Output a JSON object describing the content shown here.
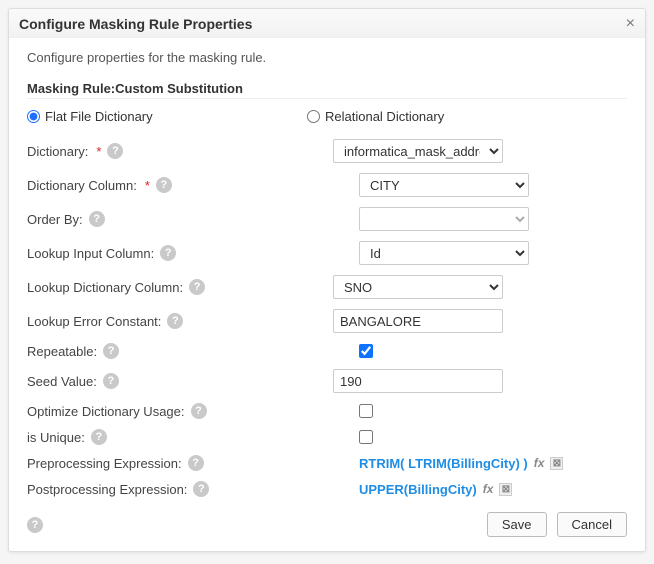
{
  "dialog": {
    "title": "Configure Masking Rule Properties",
    "description": "Configure properties for the masking rule.",
    "rule_heading": "Masking Rule:Custom Substitution"
  },
  "dictionary_type": {
    "flat_label": "Flat File Dictionary",
    "relational_label": "Relational Dictionary",
    "selected": "flat"
  },
  "fields": {
    "dictionary": {
      "label": "Dictionary:",
      "value": "informatica_mask_addre",
      "required": true
    },
    "dictionary_column": {
      "label": "Dictionary Column:",
      "value": "CITY",
      "required": true
    },
    "order_by": {
      "label": "Order By:",
      "value": ""
    },
    "lookup_input_column": {
      "label": "Lookup Input Column:",
      "value": "Id"
    },
    "lookup_dictionary_column": {
      "label": "Lookup Dictionary Column:",
      "value": "SNO"
    },
    "lookup_error_constant": {
      "label": "Lookup Error Constant:",
      "value": "BANGALORE"
    },
    "repeatable": {
      "label": "Repeatable:",
      "checked": true
    },
    "seed_value": {
      "label": "Seed Value:",
      "value": "190"
    },
    "optimize_dictionary": {
      "label": "Optimize Dictionary Usage:",
      "checked": false
    },
    "is_unique": {
      "label": "is Unique:",
      "checked": false
    },
    "preprocessing": {
      "label": "Preprocessing Expression:",
      "expression": "RTRIM( LTRIM(BillingCity) )"
    },
    "postprocessing": {
      "label": "Postprocessing Expression:",
      "expression": "UPPER(BillingCity)"
    }
  },
  "buttons": {
    "save": "Save",
    "cancel": "Cancel"
  },
  "icons": {
    "help": "?",
    "fx": "fx",
    "del": "⊠"
  }
}
